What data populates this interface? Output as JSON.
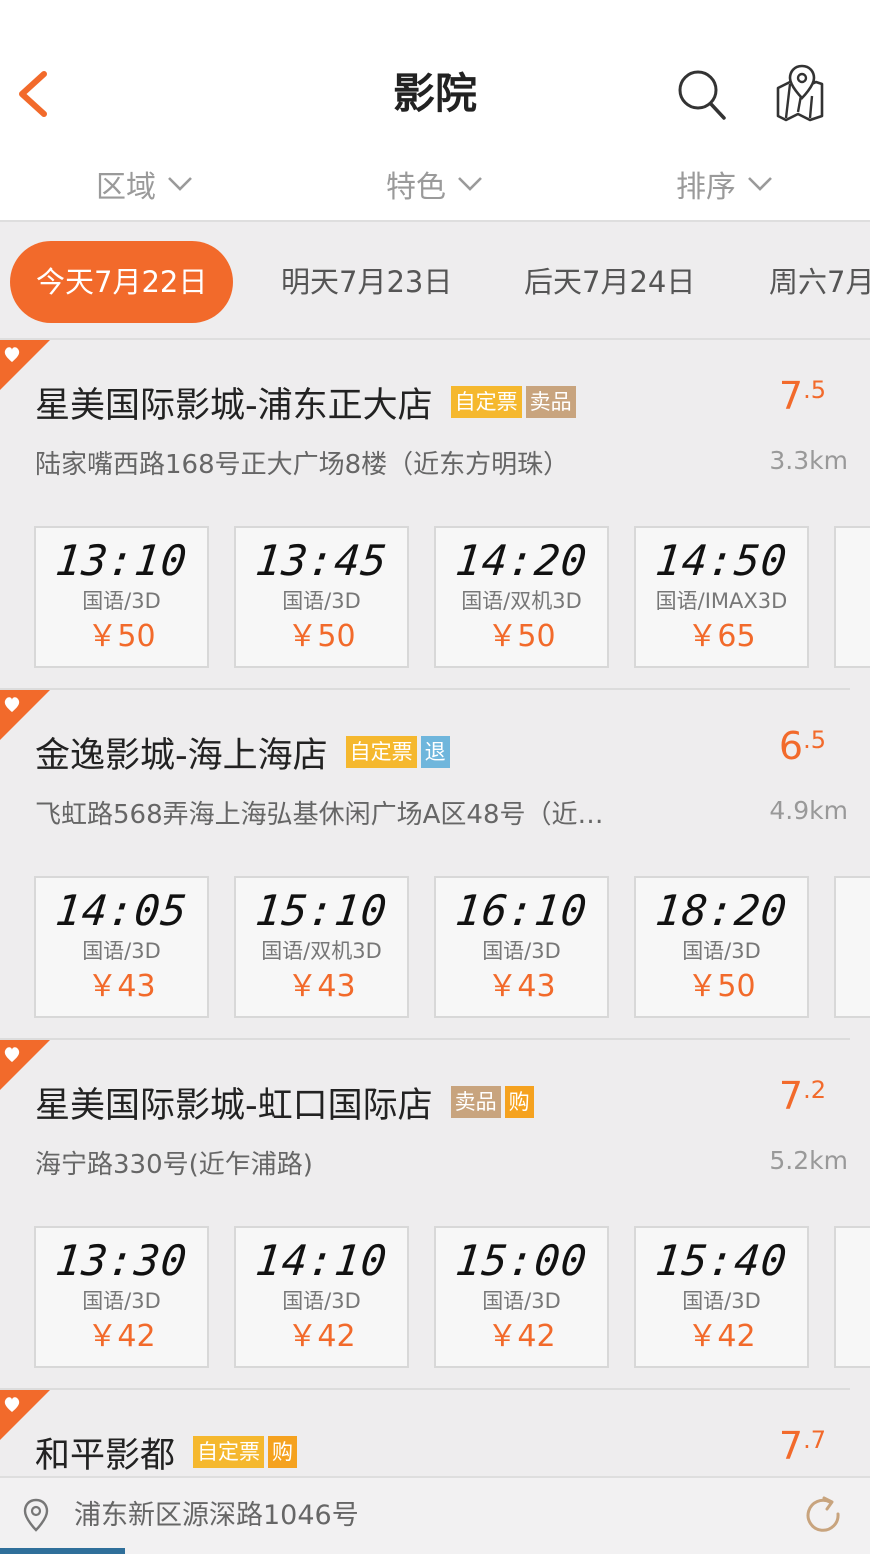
{
  "header": {
    "title": "影院"
  },
  "filters": [
    {
      "label": "区域"
    },
    {
      "label": "特色"
    },
    {
      "label": "排序"
    }
  ],
  "dates": [
    {
      "label": "今天7月22日",
      "active": true
    },
    {
      "label": "明天7月23日",
      "active": false
    },
    {
      "label": "后天7月24日",
      "active": false
    },
    {
      "label": "周六7月",
      "active": false
    }
  ],
  "cinemas": [
    {
      "name": "星美国际影城-浦东正大店",
      "tags": [
        {
          "text": "自定票",
          "color": "yellow"
        },
        {
          "text": "卖品",
          "color": "tan"
        }
      ],
      "rating_int": "7",
      "rating_dec": ".5",
      "address": "陆家嘴西路168号正大广场8楼（近东方明珠）",
      "distance": "3.3km",
      "sessions": [
        {
          "time": "13:10",
          "format": "国语/3D",
          "price": "￥50"
        },
        {
          "time": "13:45",
          "format": "国语/3D",
          "price": "￥50"
        },
        {
          "time": "14:20",
          "format": "国语/双机3D",
          "price": "￥50"
        },
        {
          "time": "14:50",
          "format": "国语/IMAX3D",
          "price": "￥65"
        }
      ]
    },
    {
      "name": "金逸影城-海上海店",
      "tags": [
        {
          "text": "自定票",
          "color": "yellow"
        },
        {
          "text": "退",
          "color": "blue"
        }
      ],
      "rating_int": "6",
      "rating_dec": ".5",
      "address": "飞虹路568弄海上海弘基休闲广场A区48号（近…",
      "distance": "4.9km",
      "sessions": [
        {
          "time": "14:05",
          "format": "国语/3D",
          "price": "￥43"
        },
        {
          "time": "15:10",
          "format": "国语/双机3D",
          "price": "￥43"
        },
        {
          "time": "16:10",
          "format": "国语/3D",
          "price": "￥43"
        },
        {
          "time": "18:20",
          "format": "国语/3D",
          "price": "￥50"
        }
      ]
    },
    {
      "name": "星美国际影城-虹口国际店",
      "tags": [
        {
          "text": "卖品",
          "color": "tan"
        },
        {
          "text": "购",
          "color": "orange"
        }
      ],
      "rating_int": "7",
      "rating_dec": ".2",
      "address": "海宁路330号(近乍浦路)",
      "distance": "5.2km",
      "sessions": [
        {
          "time": "13:30",
          "format": "国语/3D",
          "price": "￥42"
        },
        {
          "time": "14:10",
          "format": "国语/3D",
          "price": "￥42"
        },
        {
          "time": "15:00",
          "format": "国语/3D",
          "price": "￥42"
        },
        {
          "time": "15:40",
          "format": "国语/3D",
          "price": "￥42"
        }
      ]
    },
    {
      "name": "和平影都",
      "tags": [
        {
          "text": "自定票",
          "color": "yellow"
        },
        {
          "text": "购",
          "color": "orange"
        }
      ],
      "rating_int": "7",
      "rating_dec": ".7",
      "address": "",
      "distance": "",
      "sessions": []
    }
  ],
  "location": {
    "text": "浦东新区源深路1046号"
  },
  "colors": {
    "accent": "#f26a2b",
    "tag_yellow": "#f5b82e",
    "tag_tan": "#c8a47e",
    "tag_blue": "#6fb6dc",
    "tag_orange": "#f5a21f"
  },
  "icons": {
    "back": "chevron-left-icon",
    "search": "search-icon",
    "map": "map-icon",
    "favorite": "heart-icon",
    "location": "location-pin-icon",
    "refresh": "refresh-icon"
  }
}
